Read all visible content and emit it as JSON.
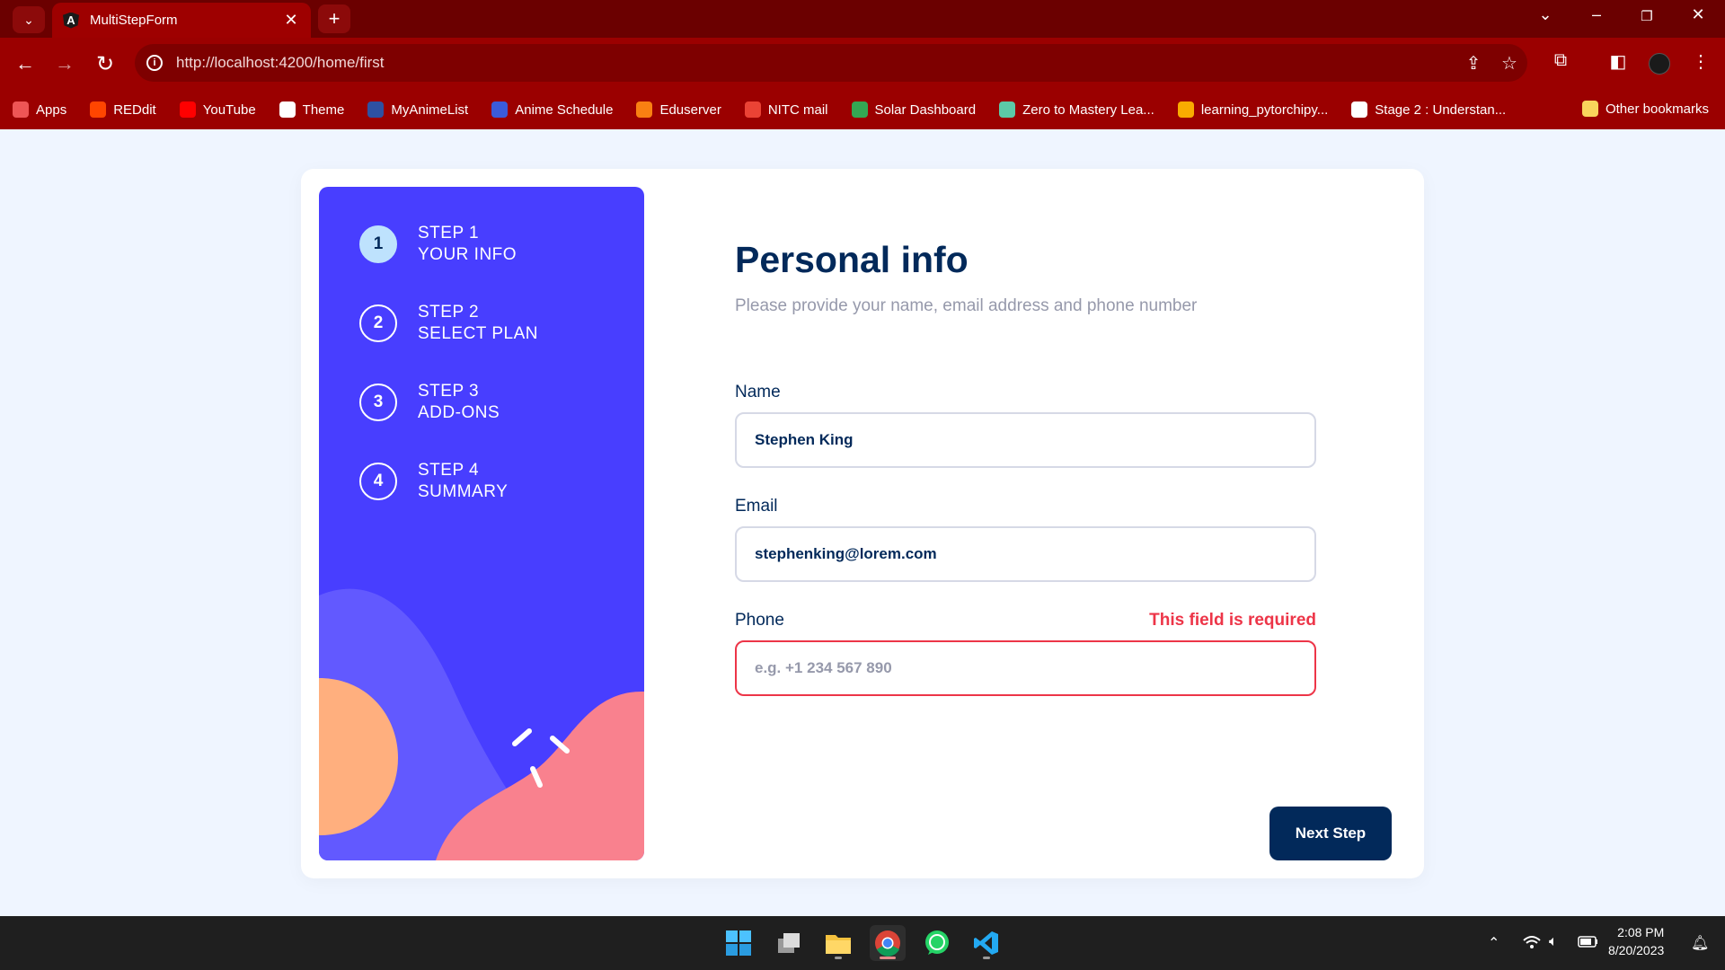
{
  "browser": {
    "tab_title": "MultiStepForm",
    "tab_favicon_letter": "A",
    "url": "http://localhost:4200/home/first",
    "bookmarks": [
      {
        "label": "Apps",
        "icon": "apps-grid-icon",
        "color": "#e55"
      },
      {
        "label": "REDdit",
        "icon": "reddit-icon",
        "color": "#ff4500"
      },
      {
        "label": "YouTube",
        "icon": "youtube-icon",
        "color": "#ff0000"
      },
      {
        "label": "Theme",
        "icon": "globe-icon",
        "color": "#ffffff"
      },
      {
        "label": "MyAnimeList",
        "icon": "myanimelist-icon",
        "color": "#2e51a2"
      },
      {
        "label": "Anime Schedule",
        "icon": "anime-schedule-icon",
        "color": "#3b5bdb"
      },
      {
        "label": "Eduserver",
        "icon": "moodle-icon",
        "color": "#f98012"
      },
      {
        "label": "NITC mail",
        "icon": "gmail-icon",
        "color": "#ea4335"
      },
      {
        "label": "Solar Dashboard",
        "icon": "solar-g-icon",
        "color": "#34a853"
      },
      {
        "label": "Zero to Mastery Lea...",
        "icon": "ztm-icon",
        "color": "#5cc9a7"
      },
      {
        "label": "learning_pytorchipy...",
        "icon": "colab-icon",
        "color": "#f9ab00"
      },
      {
        "label": "Stage 2 : Understan...",
        "icon": "openai-icon",
        "color": "#ffffff"
      }
    ],
    "other_bookmarks": "Other bookmarks"
  },
  "sidebar": {
    "steps": [
      {
        "number": "1",
        "step": "STEP 1",
        "label": "YOUR INFO",
        "active": true
      },
      {
        "number": "2",
        "step": "STEP 2",
        "label": "SELECT PLAN",
        "active": false
      },
      {
        "number": "3",
        "step": "STEP 3",
        "label": "ADD-ONS",
        "active": false
      },
      {
        "number": "4",
        "step": "STEP 4",
        "label": "SUMMARY",
        "active": false
      }
    ]
  },
  "form": {
    "title": "Personal info",
    "subtitle": "Please provide your name, email address and phone number",
    "name": {
      "label": "Name",
      "value": "Stephen King"
    },
    "email": {
      "label": "Email",
      "value": "stephenking@lorem.com"
    },
    "phone": {
      "label": "Phone",
      "value": "",
      "placeholder": "e.g. +1 234 567 890",
      "error": "This field is required"
    },
    "next_label": "Next Step"
  },
  "taskbar": {
    "time": "2:08 PM",
    "date": "8/20/2023"
  },
  "colors": {
    "sidebar_bg": "#483eff",
    "primary": "#02295a",
    "error": "#ed3548",
    "active_step": "#bee2fd"
  }
}
